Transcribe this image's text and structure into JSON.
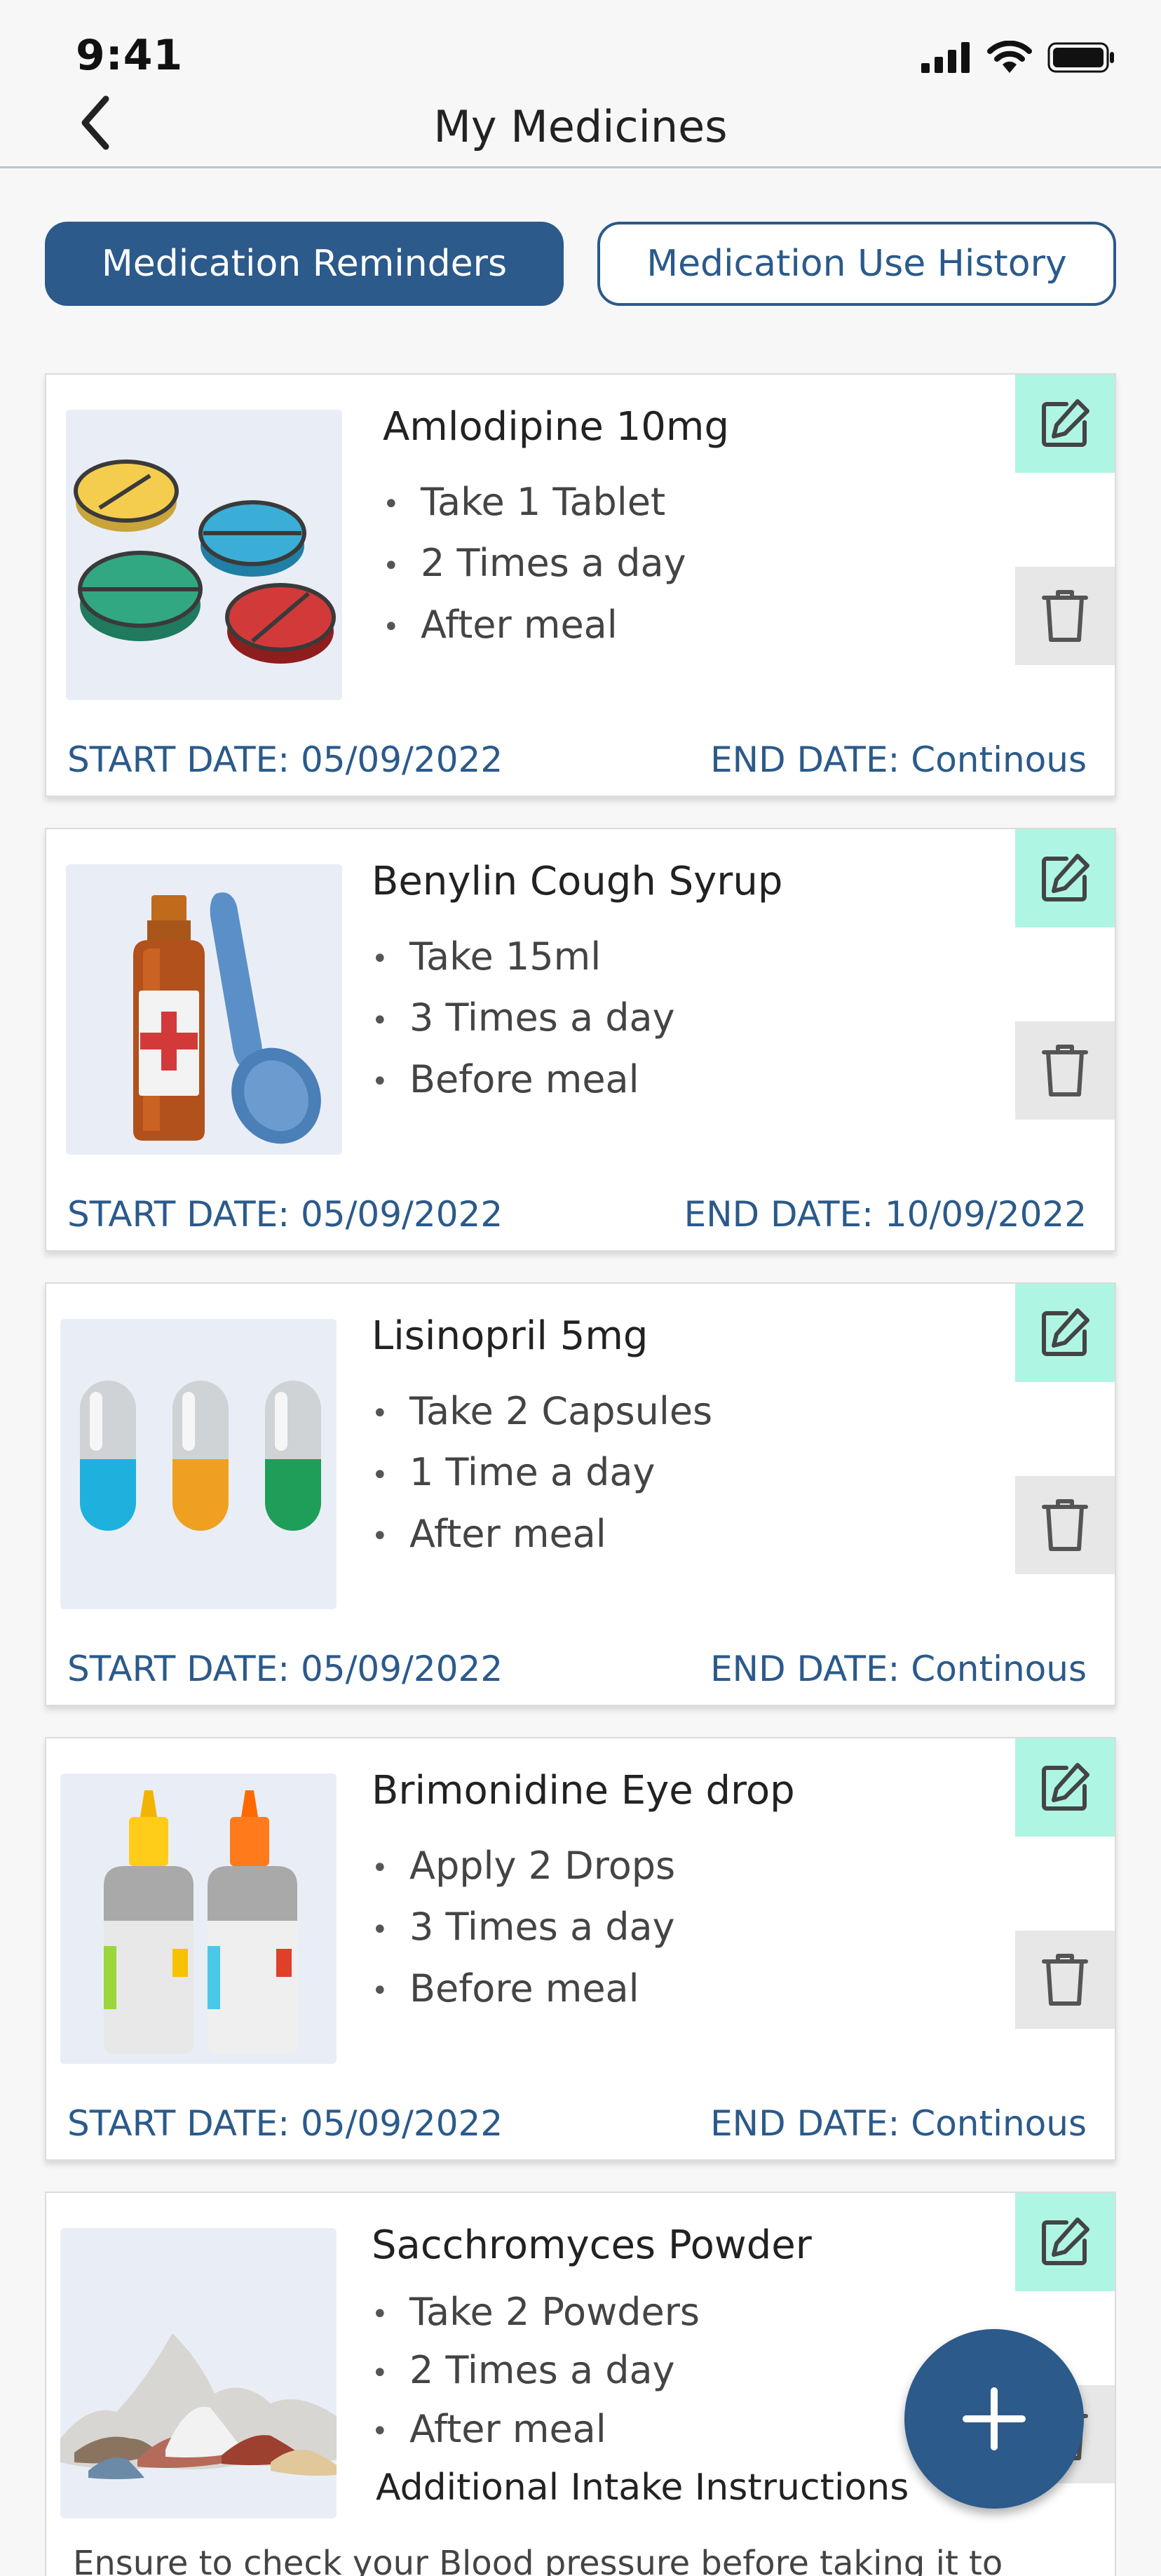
{
  "status_bar": {
    "time": "9:41"
  },
  "header": {
    "title": "My Medicines",
    "back_icon": "chevron-left-icon"
  },
  "tabs": [
    {
      "label": "Medication Reminders",
      "active": true
    },
    {
      "label": "Medication Use History",
      "active": false
    }
  ],
  "medicines": [
    {
      "name": "Amlodipine 10mg",
      "instructions": [
        "Take 1 Tablet",
        "2 Times a day",
        "After meal"
      ],
      "start_date": "START DATE: 05/09/2022",
      "end_date": "END DATE: Continous",
      "image": "tablets-illustration"
    },
    {
      "name": "Benylin Cough Syrup",
      "instructions": [
        "Take 15ml",
        "3 Times a day",
        "Before meal"
      ],
      "start_date": "START DATE: 05/09/2022",
      "end_date": "END DATE: 10/09/2022",
      "image": "syrup-bottle-illustration"
    },
    {
      "name": "Lisinopril 5mg",
      "instructions": [
        "Take 2 Capsules",
        "1 Time a day",
        "After meal"
      ],
      "start_date": "START DATE: 05/09/2022",
      "end_date": "END DATE: Continous",
      "image": "capsules-illustration"
    },
    {
      "name": "Brimonidine Eye drop",
      "instructions": [
        "Apply 2 Drops",
        "3 Times a day",
        "Before meal"
      ],
      "start_date": "START DATE: 05/09/2022",
      "end_date": "END DATE: Continous",
      "image": "eye-drop-bottles-illustration"
    },
    {
      "name": "Sacchromyces Powder",
      "instructions": [
        "Take 2 Powders",
        "2 Times a day",
        "After meal"
      ],
      "additional_heading": "Additional Intake Instructions",
      "additional_text": "Ensure to check your Blood pressure before taking it to",
      "image": "powder-piles-illustration"
    }
  ],
  "colors": {
    "primary": "#2b5a8b",
    "edit_bg": "#aef5e4",
    "delete_bg": "#e7e7e7",
    "page_bg": "#f7f7f7"
  },
  "fab": {
    "icon": "plus-icon"
  }
}
